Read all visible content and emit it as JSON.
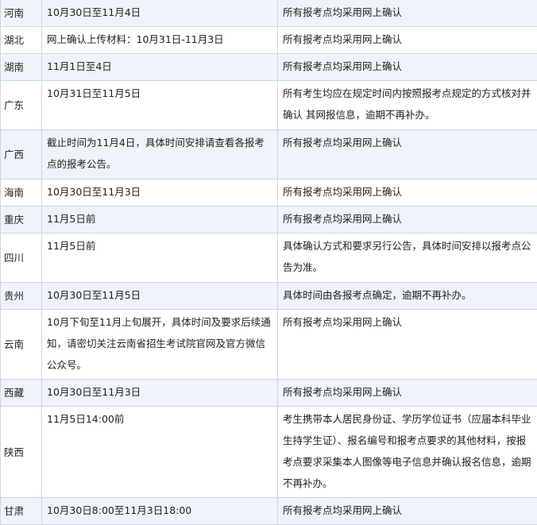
{
  "rows": [
    {
      "province": "河南",
      "date": "10月30日至11月4日",
      "note": "所有报考点均采用网上确认"
    },
    {
      "province": "湖北",
      "date": "网上确认上传材料：10月31日-11月3日",
      "note": "所有报考点均采用网上确认"
    },
    {
      "province": "湖南",
      "date": "11月1日至4日",
      "note": "所有报考点均采用网上确认"
    },
    {
      "province": "广东",
      "date": "10月31日至11月5日",
      "note": "所有考生均应在规定时间内按照报考点规定的方式核对并确认 其网报信息，逾期不再补办。"
    },
    {
      "province": "广西",
      "date": "截止时间为11月4日，具体时间安排请查看各报考点的报考公告。",
      "note": "所有报考点均采用网上确认"
    },
    {
      "province": "海南",
      "date": "10月30日至11月3日",
      "note": "所有报考点均采用网上确认"
    },
    {
      "province": "重庆",
      "date": "11月5日前",
      "note": "所有报考点均采用网上确认"
    },
    {
      "province": "四川",
      "date": "11月5日前",
      "note": "具体确认方式和要求另行公告，具体时间安排以报考点公告为准。"
    },
    {
      "province": "贵州",
      "date": "10月30日至11月5日",
      "note": "具体时间由各报考点确定，逾期不再补办。"
    },
    {
      "province": "云南",
      "date": "10月下旬至11月上旬展开，具体时间及要求后续通知，请密切关注云南省招生考试院官网及官方微信公众号。",
      "note": "所有报考点均采用网上确认"
    },
    {
      "province": "西藏",
      "date": "10月30日至11月3日",
      "note": "所有报考点均采用网上确认"
    },
    {
      "province": "陕西",
      "date": "11月5日14:00前",
      "note": "考生携带本人居民身份证、学历学位证书（应届本科毕业生持学生证）、报名编号和报考点要求的其他材料，按报考点要求采集本人图像等电子信息并确认报名信息，逾期不再补办。"
    },
    {
      "province": "甘肃",
      "date": "10月30日8:00至11月3日18:00",
      "note": "所有报考点均采用网上确认"
    }
  ]
}
